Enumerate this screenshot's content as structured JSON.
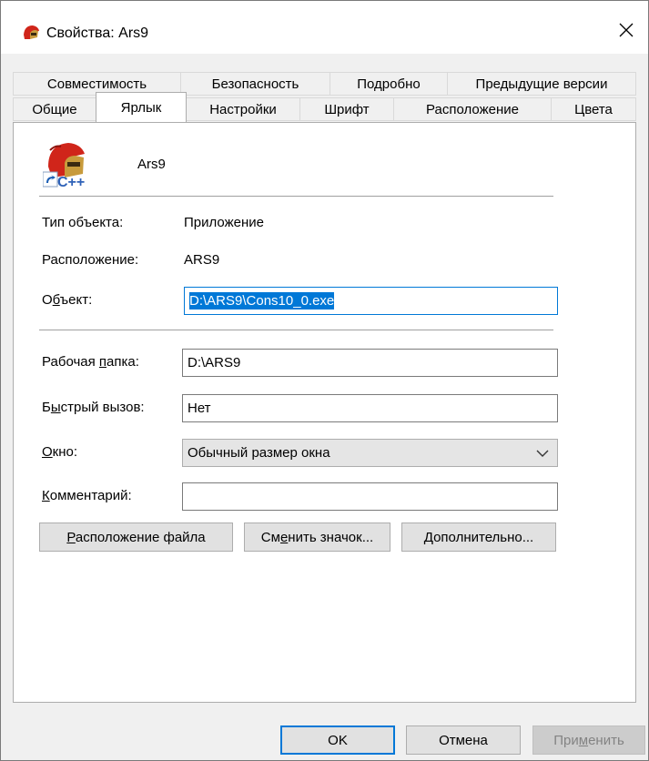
{
  "window": {
    "title": "Свойства: Ars9",
    "close_glyph": "✕"
  },
  "tabs_row_top": [
    {
      "label": "Совместимость"
    },
    {
      "label": "Безопасность"
    },
    {
      "label": "Подробно"
    },
    {
      "label": "Предыдущие версии"
    }
  ],
  "tabs_row_bottom": [
    {
      "label": "Общие"
    },
    {
      "label": "Ярлык",
      "active": true
    },
    {
      "label": "Настройки"
    },
    {
      "label": "Шрифт"
    },
    {
      "label": "Расположение"
    },
    {
      "label": "Цвета"
    }
  ],
  "shortcut": {
    "name": "Ars9",
    "type_label": "Тип объекта:",
    "type_value": "Приложение",
    "location_label": "Расположение:",
    "location_value": "ARS9",
    "target_label_a": "О",
    "target_label_u": "б",
    "target_label_b": "ъект:",
    "target_value": "D:\\ARS9\\Cons10_0.exe",
    "workdir_label_a": "Рабочая ",
    "workdir_label_u": "п",
    "workdir_label_b": "апка:",
    "workdir_value": "D:\\ARS9",
    "hotkey_label_a": "Б",
    "hotkey_label_u": "ы",
    "hotkey_label_b": "стрый вызов:",
    "hotkey_value": "Нет",
    "window_label_u": "О",
    "window_label_b": "кно:",
    "window_value": "Обычный размер окна",
    "comment_label_u": "К",
    "comment_label_b": "омментарий:",
    "comment_value": ""
  },
  "buttons": {
    "open_location_u": "Р",
    "open_location_b": "асположение файла",
    "change_icon_a": "См",
    "change_icon_u": "е",
    "change_icon_b": "нить значок...",
    "advanced_u": "Д",
    "advanced_b": "ополнительно..."
  },
  "footer": {
    "ok": "OK",
    "cancel": "Отмена",
    "apply_a": "При",
    "apply_u": "м",
    "apply_b": "енить"
  },
  "icons": {
    "app": "helmet-app-icon",
    "shortcut_overlay": "shortcut-arrow-icon",
    "close": "close-icon",
    "dropdown": "chevron-down-icon"
  },
  "colors": {
    "accent": "#0078d7",
    "helmet_red": "#d0251a",
    "helmet_gold": "#c89b3c"
  }
}
